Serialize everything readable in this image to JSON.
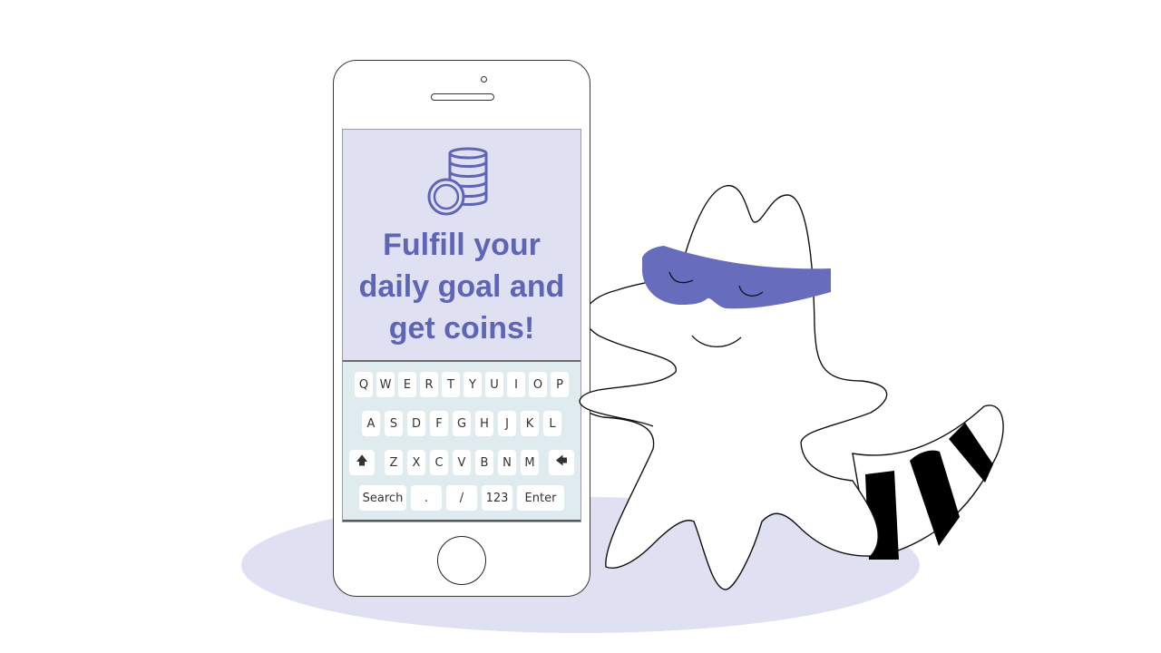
{
  "colors": {
    "accent": "#5f65b6",
    "screen_bg": "#dfe0f1",
    "keyboard_bg": "#e0ebef",
    "ground": "#dfe0f1",
    "mask": "#676cbd"
  },
  "screen": {
    "icon": "coins-icon",
    "headline_lines": [
      "Fulfill your",
      "daily goal and",
      "get coins!"
    ]
  },
  "keyboard": {
    "row1": [
      "Q",
      "W",
      "E",
      "R",
      "T",
      "Y",
      "U",
      "I",
      "O",
      "P"
    ],
    "row2": [
      "A",
      "S",
      "D",
      "F",
      "G",
      "H",
      "J",
      "K",
      "L"
    ],
    "row3": {
      "shift_icon": "shift-up-arrow-icon",
      "shift_glyph": "🡅",
      "keys": [
        "Z",
        "X",
        "C",
        "V",
        "B",
        "N",
        "M"
      ],
      "backspace_icon": "backspace-arrow-icon",
      "backspace_glyph": "🡄"
    },
    "row4": [
      "Search",
      ".",
      "/",
      "123",
      "Enter"
    ]
  },
  "character": {
    "name": "masked raccoon ghost mascot"
  }
}
